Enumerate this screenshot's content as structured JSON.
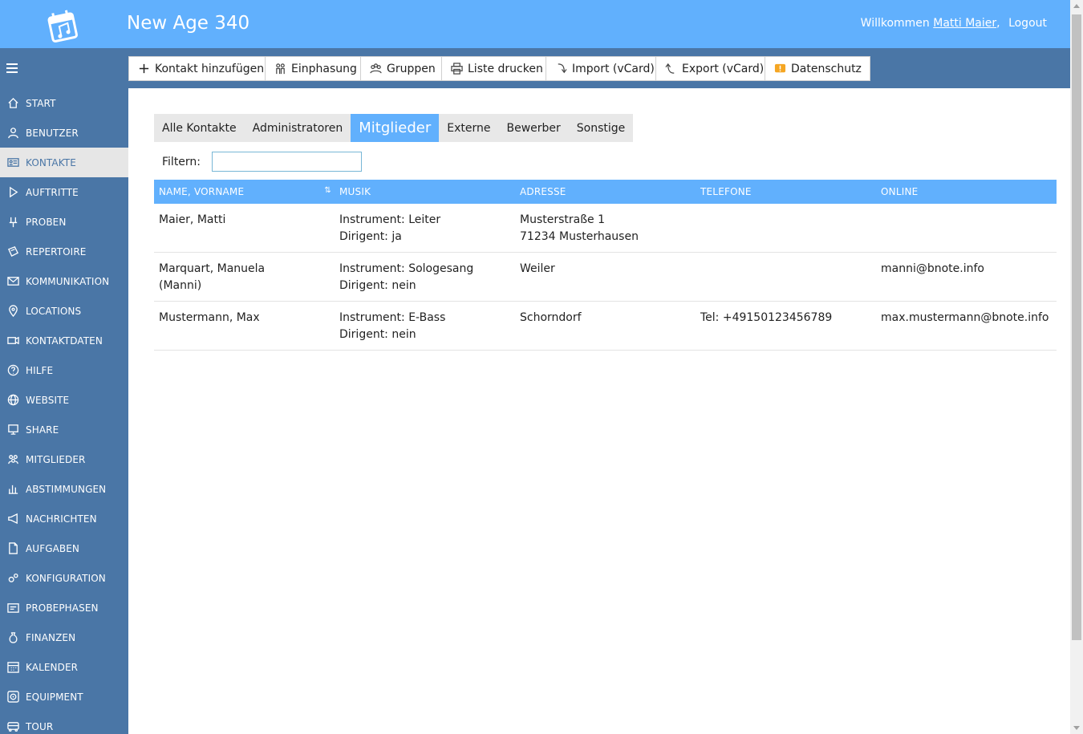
{
  "header": {
    "app_title": "New Age 340",
    "welcome_text": "Willkommen",
    "user_name": "Matti Maier",
    "user_suffix": ",",
    "logout_label": "Logout"
  },
  "sidebar": {
    "items": [
      {
        "label": "START",
        "icon": "home-icon"
      },
      {
        "label": "BENUTZER",
        "icon": "user-icon"
      },
      {
        "label": "KONTAKTE",
        "icon": "contact-card-icon"
      },
      {
        "label": "AUFTRITTE",
        "icon": "play-icon"
      },
      {
        "label": "PROBEN",
        "icon": "rehearsal-icon"
      },
      {
        "label": "REPERTOIRE",
        "icon": "repertoire-icon"
      },
      {
        "label": "KOMMUNIKATION",
        "icon": "envelope-icon"
      },
      {
        "label": "LOCATIONS",
        "icon": "location-pin-icon"
      },
      {
        "label": "KONTAKTDATEN",
        "icon": "contact-data-icon"
      },
      {
        "label": "HILFE",
        "icon": "help-icon"
      },
      {
        "label": "WEBSITE",
        "icon": "globe-icon"
      },
      {
        "label": "SHARE",
        "icon": "share-icon"
      },
      {
        "label": "MITGLIEDER",
        "icon": "members-icon"
      },
      {
        "label": "ABSTIMMUNGEN",
        "icon": "bar-chart-icon"
      },
      {
        "label": "NACHRICHTEN",
        "icon": "megaphone-icon"
      },
      {
        "label": "AUFGABEN",
        "icon": "document-icon"
      },
      {
        "label": "KONFIGURATION",
        "icon": "gears-icon"
      },
      {
        "label": "PROBEPHASEN",
        "icon": "phases-icon"
      },
      {
        "label": "FINANZEN",
        "icon": "money-bag-icon"
      },
      {
        "label": "KALENDER",
        "icon": "calendar-icon"
      },
      {
        "label": "EQUIPMENT",
        "icon": "equipment-icon"
      },
      {
        "label": "TOUR",
        "icon": "bus-icon"
      }
    ],
    "active_index": 2
  },
  "toolbar": {
    "buttons": [
      {
        "label": "Kontakt hinzufügen",
        "icon": "plus-icon"
      },
      {
        "label": "Einphasung",
        "icon": "people-icon"
      },
      {
        "label": "Gruppen",
        "icon": "group-icon"
      },
      {
        "label": "Liste drucken",
        "icon": "printer-icon"
      },
      {
        "label": "Import (vCard)",
        "icon": "import-icon"
      },
      {
        "label": "Export (vCard)",
        "icon": "export-icon"
      },
      {
        "label": "Datenschutz",
        "icon": "privacy-icon"
      }
    ]
  },
  "tabs": {
    "items": [
      "Alle Kontakte",
      "Administratoren",
      "Mitglieder",
      "Externe",
      "Bewerber",
      "Sonstige"
    ],
    "active_index": 2
  },
  "filter": {
    "label": "Filtern:",
    "value": "",
    "placeholder": ""
  },
  "table": {
    "columns": [
      "NAME, VORNAME",
      "MUSIK",
      "ADRESSE",
      "TELEFONE",
      "ONLINE"
    ],
    "rows": [
      {
        "name": "Maier, Matti",
        "name2": "",
        "instrument": "Instrument: Leiter",
        "dirigent": "Dirigent: ja",
        "address1": "Musterstraße 1",
        "address2": "71234 Musterhausen",
        "phone": "",
        "online": ""
      },
      {
        "name": "Marquart, Manuela",
        "name2": "(Manni)",
        "instrument": "Instrument: Sologesang",
        "dirigent": "Dirigent: nein",
        "address1": "Weiler",
        "address2": "",
        "phone": "",
        "online": "manni@bnote.info"
      },
      {
        "name": "Mustermann, Max",
        "name2": "",
        "instrument": "Instrument: E-Bass",
        "dirigent": "Dirigent: nein",
        "address1": "Schorndorf",
        "address2": "",
        "phone": "Tel: +49150123456789",
        "online": "max.mustermann@bnote.info"
      }
    ]
  },
  "colors": {
    "header_bg": "#61b0fd",
    "sidebar_bg": "#4a76a6",
    "accent": "#61b0fd"
  }
}
